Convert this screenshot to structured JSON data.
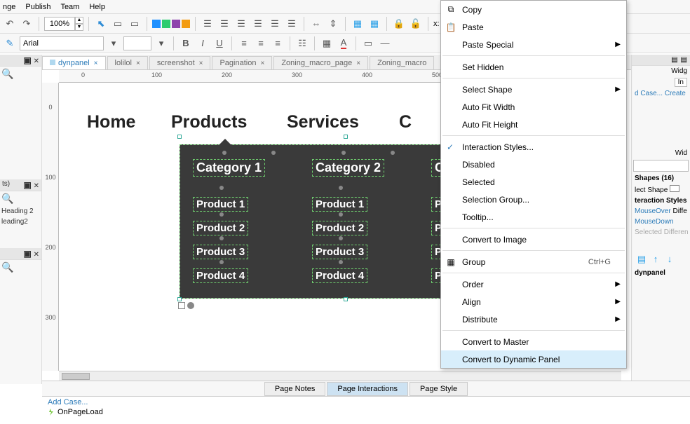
{
  "menubar": [
    "nge",
    "Publish",
    "Team",
    "Help"
  ],
  "zoom": "100%",
  "font": {
    "name": "Arial",
    "size": ""
  },
  "tabs": [
    {
      "label": "dynpanel",
      "active": true
    },
    {
      "label": "lolilol"
    },
    {
      "label": "screenshot"
    },
    {
      "label": "Pagination"
    },
    {
      "label": "Zoning_macro_page"
    },
    {
      "label": "Zoning_macro"
    }
  ],
  "ruler_h": [
    "0",
    "100",
    "200",
    "300",
    "400",
    "500"
  ],
  "ruler_v": [
    "0",
    "100",
    "200",
    "300"
  ],
  "nav": {
    "home": "Home",
    "products": "Products",
    "services": "Services",
    "c": "C"
  },
  "flyout": {
    "col1": {
      "title": "Category 1",
      "p1": "Product 1",
      "p2": "Product 2",
      "p3": "Product 3",
      "p4": "Product 4"
    },
    "col2": {
      "title": "Category 2",
      "p1": "Product 1",
      "p2": "Product 2",
      "p3": "Product 3",
      "p4": "Product 4"
    },
    "col3": {
      "title": "Ca",
      "p1": "P",
      "p2": "P",
      "p3": "P",
      "p4": "P"
    }
  },
  "ctx": {
    "copy": "Copy",
    "paste": "Paste",
    "paste_special": "Paste Special",
    "set_hidden": "Set Hidden",
    "select_shape": "Select Shape",
    "auto_w": "Auto Fit Width",
    "auto_h": "Auto Fit Height",
    "interaction": "Interaction Styles...",
    "disabled": "Disabled",
    "selected": "Selected",
    "sel_group": "Selection Group...",
    "tooltip": "Tooltip...",
    "to_image": "Convert to Image",
    "group": "Group",
    "group_sc": "Ctrl+G",
    "order": "Order",
    "align": "Align",
    "distribute": "Distribute",
    "to_master": "Convert to Master",
    "to_dp": "Convert to Dynamic Panel"
  },
  "page_tabs": {
    "notes": "Page Notes",
    "interactions": "Page Interactions",
    "style": "Page Style"
  },
  "case_panel": {
    "add": "Add Case...",
    "event": "OnPageLoad"
  },
  "left": {
    "ts": "ts)",
    "h2": "Heading 2",
    "h2b": "leading2"
  },
  "right": {
    "widg": "Widg",
    "wid": "Wid",
    "in_btn": "In",
    "d_case": "d Case...",
    "create": "Create",
    "shapes": "Shapes (16)",
    "lect": "lect Shape",
    "istyles": "teraction Styles",
    "mover": "MouseOver",
    "diff": "Diffe",
    "mdown": "MouseDown",
    "sel": "Selected",
    "diff2": "Differen",
    "dynpanel": "dynpanel"
  }
}
